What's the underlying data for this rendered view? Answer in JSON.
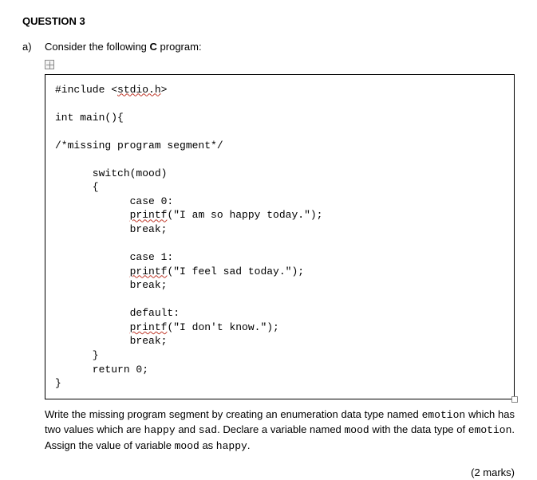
{
  "question_title": "QUESTION 3",
  "part_label": "a)",
  "intro_pre": "Consider the following ",
  "intro_bold": "C",
  "intro_post": " program:",
  "code": {
    "l1a": "#include <",
    "l1b": "stdio.h",
    "l1c": ">",
    "l2": "",
    "l3": "int main(){",
    "l4": "",
    "l5": "/*missing program segment*/",
    "l6": "",
    "l7": "      switch(mood)",
    "l8": "      {",
    "l9": "            case 0:",
    "l10a": "            ",
    "l10b": "printf",
    "l10c": "(\"I am so happy today.\");",
    "l11": "            break;",
    "l12": "",
    "l13": "            case 1:",
    "l14a": "            ",
    "l14b": "printf",
    "l14c": "(\"I feel sad today.\");",
    "l15": "            break;",
    "l16": "",
    "l17": "            default:",
    "l18a": "            ",
    "l18b": "printf",
    "l18c": "(\"I don't know.\");",
    "l19": "            break;",
    "l20": "      }",
    "l21": "      return 0;",
    "l22": "}"
  },
  "instr": {
    "t1": "Write the missing program segment by creating an enumeration data type named ",
    "c1": "emotion",
    "t2": " which has two values which are ",
    "c2": "happy",
    "t3": " and ",
    "c3": "sad",
    "t4": ". Declare a variable named ",
    "c4": "mood",
    "t5": " with the data type of ",
    "c5": "emotion",
    "t6": ". Assign the value of variable ",
    "c6": "mood",
    "t7": " as ",
    "c7": "happy",
    "t8": "."
  },
  "marks": "(2 marks)"
}
